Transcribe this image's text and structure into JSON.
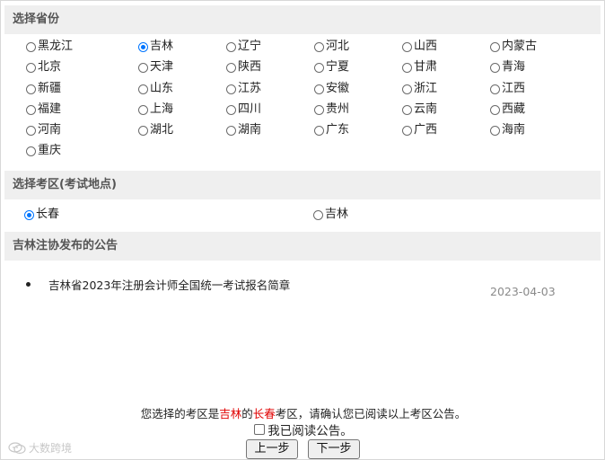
{
  "province_section": {
    "header": "选择省份",
    "provinces": [
      "黑龙江",
      "吉林",
      "辽宁",
      "河北",
      "山西",
      "内蒙古",
      "北京",
      "天津",
      "陕西",
      "宁夏",
      "甘肃",
      "青海",
      "新疆",
      "山东",
      "江苏",
      "安徽",
      "浙江",
      "江西",
      "福建",
      "上海",
      "四川",
      "贵州",
      "云南",
      "西藏",
      "河南",
      "湖北",
      "湖南",
      "广东",
      "广西",
      "海南",
      "重庆"
    ],
    "selected": "吉林"
  },
  "exam_area_section": {
    "header": "选择考区(考试地点)",
    "areas": [
      "长春",
      "吉林"
    ],
    "selected": "长春"
  },
  "notice_section": {
    "header": "吉林注协发布的公告",
    "items": [
      {
        "title": "吉林省2023年注册会计师全国统一考试报名简章",
        "date": "2023-04-03"
      }
    ]
  },
  "confirm": {
    "prefix": "您选择的考区是",
    "province": "吉林",
    "middle": "的",
    "area": "长春",
    "suffix": "考区，请确认您已阅读以上考区公告。",
    "checkbox_label": "我已阅读公告。",
    "checkbox_checked": false
  },
  "buttons": {
    "prev": "上一步",
    "next": "下一步"
  },
  "watermark": {
    "text": "大数跨境",
    "icon": "chat-bubble-icon"
  },
  "colors": {
    "accent": "#0075ff",
    "highlight": "#e00000",
    "header_bg": "#efefef",
    "date": "#8a8a8a"
  }
}
